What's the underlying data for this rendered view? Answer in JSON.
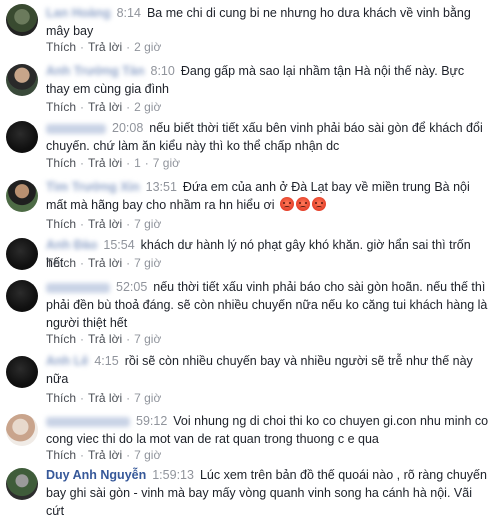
{
  "comments": [
    {
      "name": "Lan Hoàng",
      "time": "8:14",
      "text": "Ba me chi di cung bi ne nhưng ho dưa khách về vinh bằng mây bay",
      "reply": "Thích",
      "answer": "Trả lời",
      "ago": "2 giờ"
    },
    {
      "name": "Anh Trường Tàn",
      "time": "8:10",
      "text": "Đang gấp mà sao lại nhầm tận Hà nội thế này. Bực thay em cùng gia đình",
      "reply": "Thích",
      "answer": "Trả lời",
      "ago": "2 giờ"
    },
    {
      "name": "",
      "time": "20:08",
      "text": "nếu biết thời tiết xấu bên vinh phải báo sài gòn để khách đổi chuyến. chứ làm ăn kiểu này thì ko thể chấp nhận dc",
      "reply": "Thích",
      "answer": "Trả lời",
      "count": "1",
      "ago": "7 giờ"
    },
    {
      "name": "Tìm Trường Xin",
      "time": "13:51",
      "text": "Đứa em của anh ở Đà Lạt bay về miền trung Bà nội mất mà hãng bay cho nhầm ra hn hiểu ơi",
      "reply": "Thích",
      "answer": "Trả lời",
      "ago": "7 giờ"
    },
    {
      "name": "Anh Đào",
      "time": "15:54",
      "text": "khách dư hành lý nó phạt gây khó khăn. giờ hẩn sai thì trốn hết",
      "reply": "Thích",
      "answer": "Trả lời",
      "ago": "7 giờ"
    },
    {
      "name": "",
      "time": "52:05",
      "text": "nếu thời tiết xấu vinh phải báo cho sài gòn hoãn. nếu thế thì phải đền bù thoả đáng. sẽ còn nhiều chuyến nữa nếu ko căng tui khách hàng là người thiệt hết",
      "reply": "Thích",
      "answer": "Trả lời",
      "ago": "7 giờ"
    },
    {
      "name": "Anh Lê",
      "time": "4:15",
      "text": "rồi sẽ còn nhiều chuyến bay và nhiều người sẽ trễ như thế này nữa",
      "reply": "Thích",
      "answer": "Trả lời",
      "ago": "7 giờ"
    },
    {
      "name": "",
      "time": "59:12",
      "text": "Voi nhung ng di choi thi ko co chuyen gi.con nhu minh co cong viec thi do la mot van de rat quan trong thuong c e qua",
      "reply": "Thích",
      "answer": "Trả lời",
      "ago": "7 giờ"
    },
    {
      "name": "Duy Anh Nguyễn",
      "time": "1:59:13",
      "text": "Lúc xem trên bản đồ thế quoái nào , rõ ràng chuyến bay ghi sài gòn - vinh mà bay mấy vòng quanh vinh song ha cánh hà nội. Vãi cứt",
      "reply": "Thích",
      "answer": "Trả lời",
      "ago": "7 giờ"
    }
  ]
}
